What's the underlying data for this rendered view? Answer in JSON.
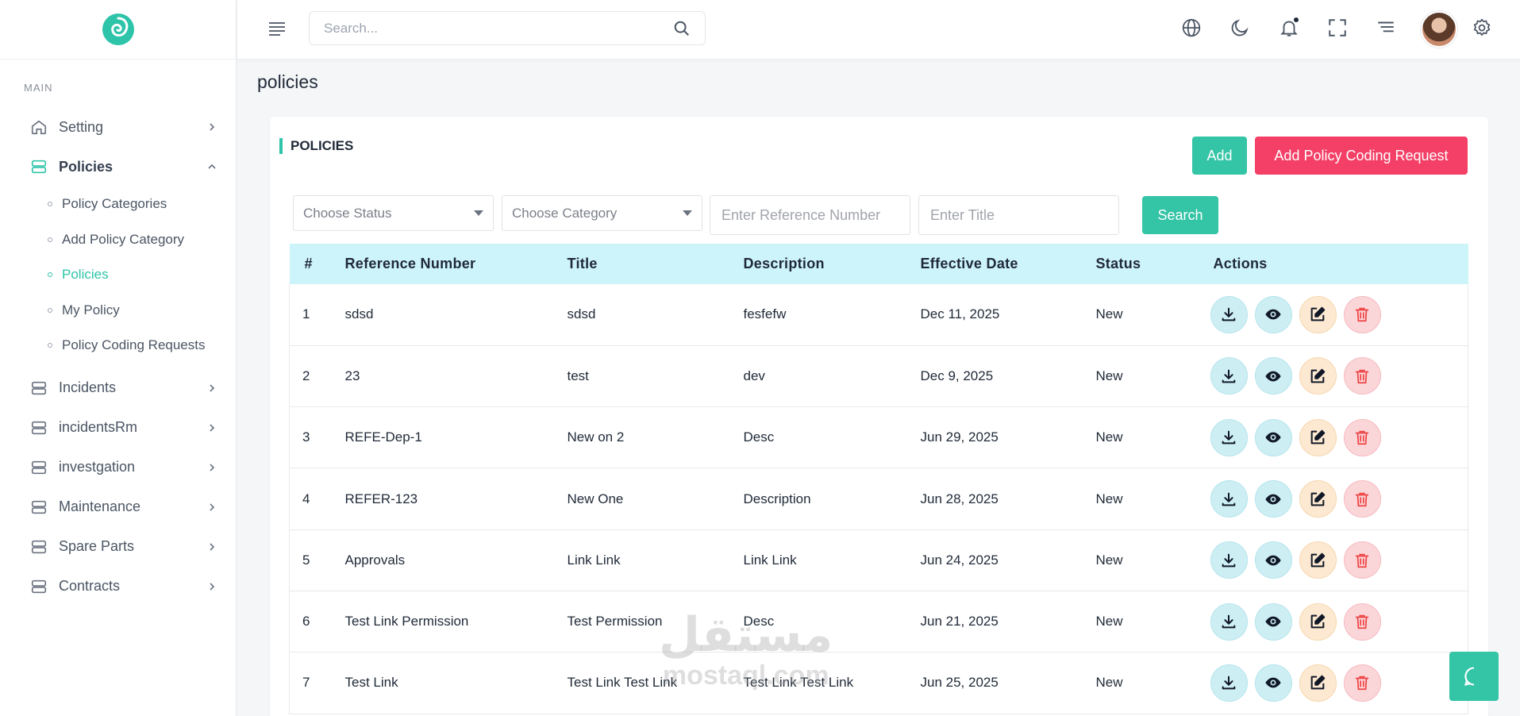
{
  "sidebar": {
    "section": "MAIN",
    "items": [
      {
        "label": "Setting",
        "expanded": false
      },
      {
        "label": "Policies",
        "expanded": true,
        "children": [
          {
            "label": "Policy Categories"
          },
          {
            "label": "Add Policy Category"
          },
          {
            "label": "Policies",
            "active": true
          },
          {
            "label": "My Policy"
          },
          {
            "label": "Policy Coding Requests"
          }
        ]
      },
      {
        "label": "Incidents",
        "expanded": false
      },
      {
        "label": "incidentsRm",
        "expanded": false
      },
      {
        "label": "investgation",
        "expanded": false
      },
      {
        "label": "Maintenance",
        "expanded": false
      },
      {
        "label": "Spare Parts",
        "expanded": false
      },
      {
        "label": "Contracts",
        "expanded": false
      }
    ]
  },
  "topbar": {
    "search_placeholder": "Search..."
  },
  "page": {
    "title": "policies",
    "card_title": "POLICIES",
    "add_label": "Add",
    "coding_label": "Add Policy Coding Request",
    "search_label": "Search",
    "filters": {
      "status_placeholder": "Choose Status",
      "category_placeholder": "Choose Category",
      "reference_placeholder": "Enter Reference Number",
      "title_placeholder": "Enter Title"
    }
  },
  "table": {
    "headers": [
      "#",
      "Reference Number",
      "Title",
      "Description",
      "Effective Date",
      "Status",
      "Actions"
    ],
    "rows": [
      {
        "num": "1",
        "ref": "sdsd",
        "title": "sdsd",
        "desc": "fesfefw",
        "date": "Dec 11, 2025",
        "status": "New"
      },
      {
        "num": "2",
        "ref": "23",
        "title": "test",
        "desc": "dev",
        "date": "Dec 9, 2025",
        "status": "New"
      },
      {
        "num": "3",
        "ref": "REFE-Dep-1",
        "title": "New on 2",
        "desc": "Desc",
        "date": "Jun 29, 2025",
        "status": "New"
      },
      {
        "num": "4",
        "ref": "REFER-123",
        "title": "New One",
        "desc": "Description",
        "date": "Jun 28, 2025",
        "status": "New"
      },
      {
        "num": "5",
        "ref": "Approvals",
        "title": "Link Link",
        "desc": "Link Link",
        "date": "Jun 24, 2025",
        "status": "New"
      },
      {
        "num": "6",
        "ref": "Test Link Permission",
        "title": "Test Permission",
        "desc": "Desc",
        "date": "Jun 21, 2025",
        "status": "New"
      },
      {
        "num": "7",
        "ref": "Test Link",
        "title": "Test Link Test Link",
        "desc": "Test Link Test Link",
        "date": "Jun 25, 2025",
        "status": "New"
      }
    ]
  },
  "watermark": {
    "line1": "مستقل",
    "line2": "mostaql.com"
  },
  "colors": {
    "accent": "#34c4a6",
    "danger": "#f43f66",
    "header_bg": "#cdf3fb"
  },
  "icons": {
    "topbar": [
      "menu-icon",
      "search-icon",
      "globe-icon",
      "moon-icon",
      "bell-icon",
      "fullscreen-icon",
      "list-icon",
      "settings-icon"
    ],
    "row_actions": [
      "download-icon",
      "eye-icon",
      "edit-icon",
      "trash-icon"
    ]
  }
}
